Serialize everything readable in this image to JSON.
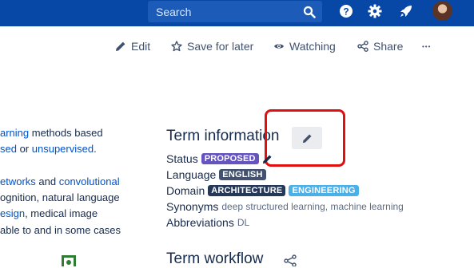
{
  "topbar": {
    "search_placeholder": "Search",
    "icons": [
      "search-icon",
      "help-icon",
      "gear-icon",
      "rocket-icon"
    ],
    "bg": "#0747a6"
  },
  "actions": {
    "edit": "Edit",
    "save_for_later": "Save for later",
    "watching": "Watching",
    "share": "Share",
    "more": "•••"
  },
  "left_text": {
    "line1_link": "arning",
    "line1_rest": " methods based",
    "line2_link1": "sed",
    "line2_mid": " or ",
    "line2_link2": "unsupervised",
    "line2_end": ".",
    "line3_link1": "etworks",
    "line3_mid": " and ",
    "line3_link2": "convolutional",
    "line4": "ognition, natural language",
    "line5_link": "esign",
    "line5_rest": ", medical image",
    "line6": "able to and in some cases"
  },
  "term_info": {
    "title": "Term information",
    "status_label": "Status",
    "status_value": "PROPOSED",
    "language_label": "Language",
    "language_value": "ENGLISH",
    "domain_label": "Domain",
    "domain_values": [
      "ARCHITECTURE",
      "ENGINEERING"
    ],
    "synonyms_label": "Synonyms",
    "synonyms_value": "deep structured learning, machine learning",
    "abbreviations_label": "Abbreviations",
    "abbreviations_value": "DL"
  },
  "term_workflow": {
    "title": "Term workflow"
  },
  "colors": {
    "proposed": "#6554c0",
    "english": "#42526e",
    "architecture": "#253858",
    "engineering": "#4ab0ea",
    "highlight": "#e01010",
    "link": "#0052cc"
  }
}
